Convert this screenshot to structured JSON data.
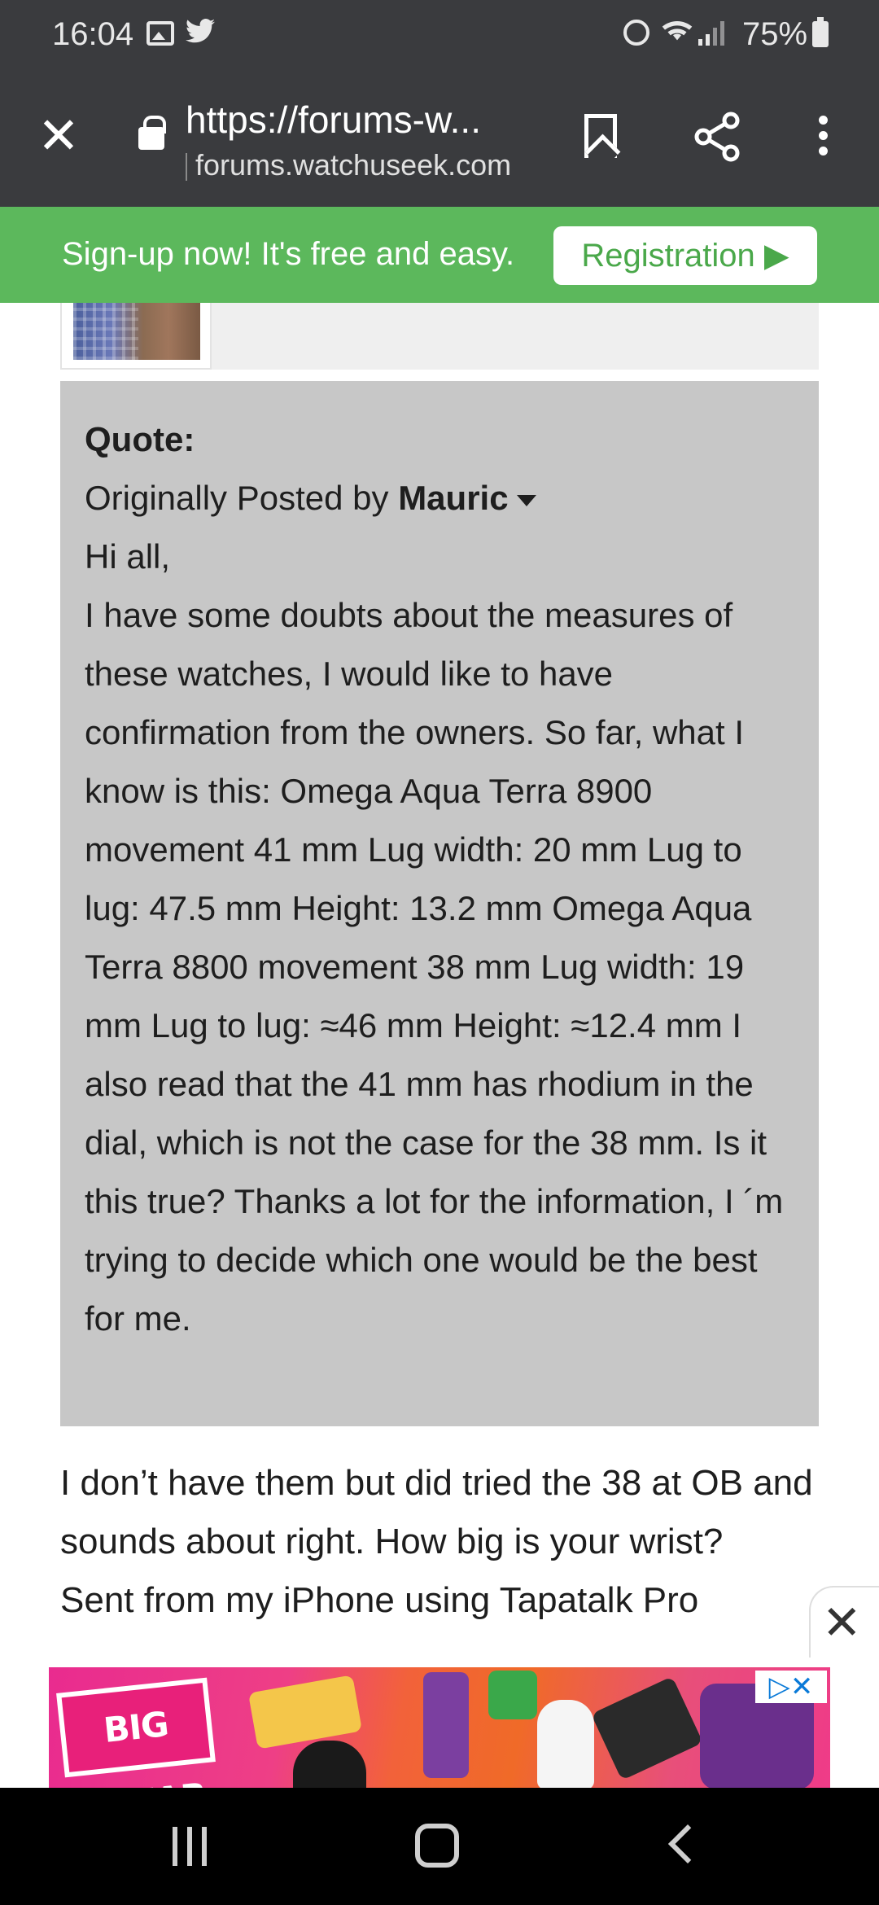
{
  "status_bar": {
    "time": "16:04",
    "battery": "75%",
    "icons": [
      "gallery-icon",
      "twitter-icon",
      "alarm-icon",
      "wifi-icon",
      "signal-icon",
      "battery-icon"
    ]
  },
  "browser": {
    "url": "https://forums-w...",
    "domain": "forums.watchuseek.com",
    "icons": [
      "close-icon",
      "lock-icon",
      "bookmark-icon",
      "share-icon",
      "more-vert-icon"
    ]
  },
  "signup_banner": {
    "text": "Sign-up now! It's free and easy.",
    "button": "Registration ▶",
    "color": "#5cb85c"
  },
  "quote": {
    "title": "Quote:",
    "originally_posted_by": "Originally Posted by ",
    "author": "Mauric",
    "greeting": "Hi all,",
    "body": "I have some doubts about the measures of these watches, I would like to have confirmation from the owners. So far, what I know is this: Omega Aqua Terra 8900 movement 41 mm Lug width: 20 mm Lug to lug: 47.5 mm Height: 13.2 mm Omega Aqua Terra 8800 movement 38 mm Lug width: 19 mm Lug to lug: ≈46 mm Height: ≈12.4 mm I also read that the 41 mm has rhodium in the dial, which is not the case for the 38 mm. Is it this true? Thanks a lot for the information, I ´m trying to decide which one would be the best for me."
  },
  "reply": {
    "text": "I don’t have them but did tried the 38 at OB and sounds about right. How big is your wrist?",
    "signature": "Sent from my iPhone using Tapatalk Pro"
  },
  "ad": {
    "brand": "BIG BAZAR",
    "badge": "▷✕",
    "close": "✕"
  },
  "nav": {
    "icons": [
      "recent-apps-icon",
      "home-icon",
      "back-icon"
    ]
  }
}
